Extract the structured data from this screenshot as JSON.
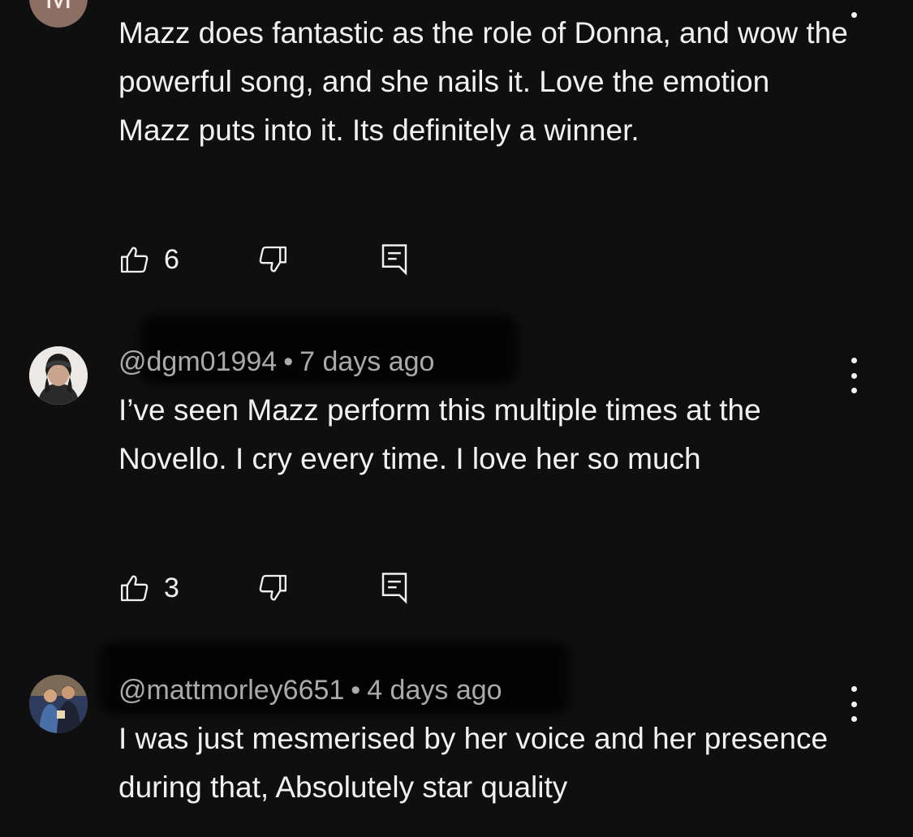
{
  "comments": [
    {
      "avatar_letter": "M",
      "avatar_color": "#8d6e63",
      "text": "Mazz does fantastic as the role of Donna, and wow the powerful song, and she nails it. Love the emotion Mazz puts into it. Its definitely a winner.",
      "likes": "6"
    },
    {
      "handle": "@dgm01994",
      "time": "7 days ago",
      "text": "I’ve seen Mazz perform this multiple times at the Novello. I cry every time. I love her so much",
      "likes": "3"
    },
    {
      "handle": "@mattmorley6651",
      "time": "4 days ago",
      "text": "I was just mesmerised by her voice and her presence during that, Absolutely star quality"
    }
  ],
  "icons": {
    "like": "thumb-up-icon",
    "dislike": "thumb-down-icon",
    "reply": "reply-icon",
    "more": "more-vertical-icon"
  },
  "meta_separator": "•"
}
